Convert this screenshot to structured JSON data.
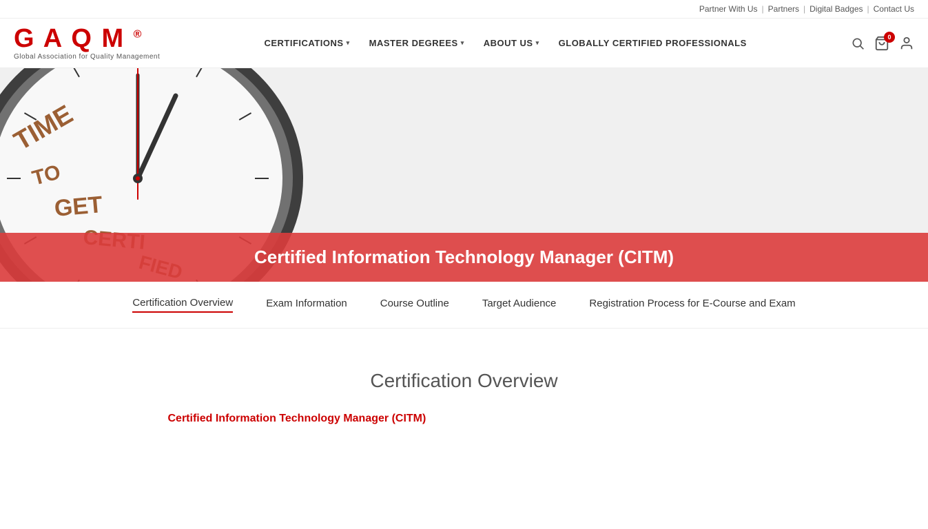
{
  "topbar": {
    "links": [
      {
        "label": "Partner With Us",
        "name": "partner-with-us-link"
      },
      {
        "label": "Partners",
        "name": "partners-link"
      },
      {
        "label": "Digital Badges",
        "name": "digital-badges-link"
      },
      {
        "label": "Contact Us",
        "name": "contact-us-link"
      }
    ]
  },
  "logo": {
    "text": "GAQM",
    "registered": "®",
    "subtext": "Global Association for Quality Management"
  },
  "nav": {
    "items": [
      {
        "label": "CERTIFICATIONS",
        "hasDropdown": true,
        "name": "nav-certifications"
      },
      {
        "label": "MASTER DEGREES",
        "hasDropdown": true,
        "name": "nav-master-degrees"
      },
      {
        "label": "ABOUT US",
        "hasDropdown": true,
        "name": "nav-about-us"
      },
      {
        "label": "GLOBALLY CERTIFIED PROFESSIONALS",
        "hasDropdown": false,
        "name": "nav-globally-certified"
      }
    ]
  },
  "cart": {
    "count": "0"
  },
  "hero": {
    "title": "Certified Information Technology Manager (CITM)"
  },
  "tabs": [
    {
      "label": "Certification Overview",
      "name": "tab-certification-overview",
      "active": true
    },
    {
      "label": "Exam Information",
      "name": "tab-exam-information",
      "active": false
    },
    {
      "label": "Course Outline",
      "name": "tab-course-outline",
      "active": false
    },
    {
      "label": "Target Audience",
      "name": "tab-target-audience",
      "active": false
    },
    {
      "label": "Registration Process for E-Course and Exam",
      "name": "tab-registration-process",
      "active": false
    }
  ],
  "content": {
    "section_title": "Certification Overview",
    "cert_subtitle": "Certified Information Technology Manager (CITM)"
  }
}
